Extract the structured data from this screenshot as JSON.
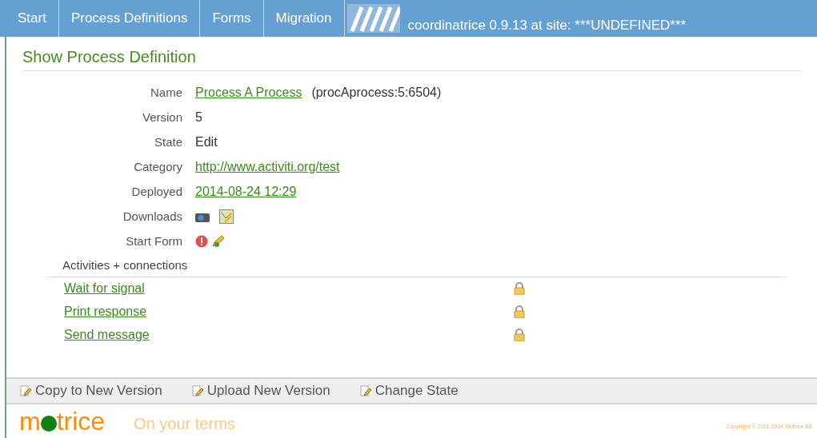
{
  "nav": {
    "tabs": [
      {
        "label": "Start",
        "selected": false
      },
      {
        "label": "Process Definitions",
        "selected": false
      },
      {
        "label": "Forms",
        "selected": false
      },
      {
        "label": "Migration",
        "selected": false
      }
    ],
    "site_text": "coordinatrice 0.9.13 at site: ***UNDEFINED***"
  },
  "heading": "Show Process Definition",
  "fields": [
    {
      "kind": "link",
      "label": "Name",
      "value": "Process A Process",
      "extra": "(procAprocess:5:6504)"
    },
    {
      "kind": "text",
      "label": "Version",
      "value": "5"
    },
    {
      "kind": "text",
      "label": "State",
      "value": "Edit"
    },
    {
      "kind": "link",
      "label": "Category",
      "value": "http://www.activiti.org/test"
    },
    {
      "kind": "link",
      "label": "Deployed",
      "value": "2014-08-24 12:29"
    },
    {
      "kind": "downloads",
      "label": "Downloads"
    },
    {
      "kind": "startform",
      "label": "Start Form"
    }
  ],
  "activities": {
    "title": "Activities + connections",
    "items": [
      {
        "label": "Wait for signal",
        "locked": true
      },
      {
        "label": "Print response",
        "locked": true
      },
      {
        "label": "Send message",
        "locked": true
      }
    ]
  },
  "actions": [
    "Copy to New Version",
    "Upload New Version",
    "Change State"
  ],
  "footer": {
    "logo_start": "m",
    "logo_end": "trice",
    "tagline": "On your terms",
    "copyright": "Copyright © 2011-2014 Motrice AB"
  }
}
